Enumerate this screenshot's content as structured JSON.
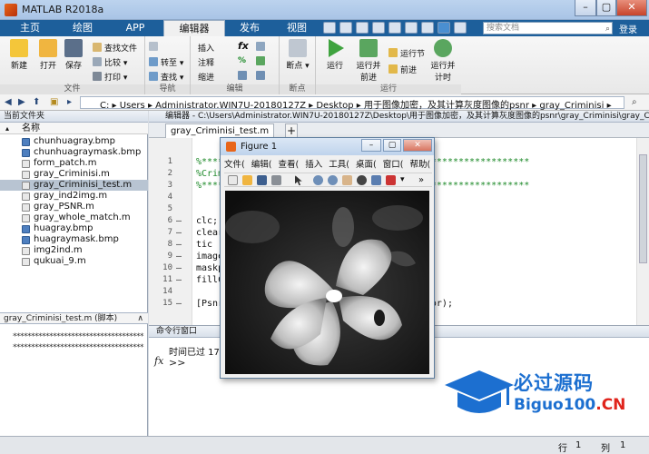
{
  "window": {
    "title": "MATLAB R2018a"
  },
  "tabs": [
    "主页",
    "绘图",
    "APP",
    "编辑器",
    "发布",
    "视图"
  ],
  "active_tab": "编辑器",
  "search": {
    "placeholder": "搜索文档"
  },
  "login_label": "登录",
  "ribbon": {
    "file": {
      "new": "新建",
      "open": "打开",
      "save": "保存",
      "find_files": "查找文件",
      "compare": "比较",
      "print": "打印",
      "group": "文件"
    },
    "navigate": {
      "goto": "转至",
      "find": "查找",
      "group": "导航"
    },
    "edit": {
      "insert": "插入",
      "comment": "注释",
      "indent": "缩进",
      "fx": "fx",
      "group": "编辑"
    },
    "breakpoints": {
      "label": "断点",
      "group": "断点"
    },
    "run": {
      "run": "运行",
      "run_advance": "运行并\n前进",
      "run_section": "运行节",
      "advance": "前进",
      "run_time": "运行并\n计时",
      "group": "运行"
    }
  },
  "address": {
    "path": [
      "C:",
      "Users",
      "Administrator.WIN7U-20180127Z",
      "Desktop",
      "用于图像加密，及其计算灰度图像的psnr",
      "gray_Criminisi"
    ]
  },
  "left_panel": {
    "title": "当前文件夹",
    "column": "名称",
    "files": [
      {
        "name": "chunhuagray.bmp",
        "type": "img"
      },
      {
        "name": "chunhuagraymask.bmp",
        "type": "img"
      },
      {
        "name": "form_patch.m",
        "type": "m"
      },
      {
        "name": "gray_Criminisi.m",
        "type": "m"
      },
      {
        "name": "gray_Criminisi_test.m",
        "type": "m",
        "selected": true
      },
      {
        "name": "gray_ind2img.m",
        "type": "m"
      },
      {
        "name": "gray_PSNR.m",
        "type": "m"
      },
      {
        "name": "gray_whole_match.m",
        "type": "m"
      },
      {
        "name": "huagray.bmp",
        "type": "img"
      },
      {
        "name": "huagraymask.bmp",
        "type": "img"
      },
      {
        "name": "img2ind.m",
        "type": "m"
      },
      {
        "name": "qukuai_9.m",
        "type": "m"
      }
    ],
    "details_title": "gray_Criminisi_test.m  (脚本)",
    "details_line1": "************************************",
    "details_line2": "************************************"
  },
  "editor": {
    "header": "编辑器 - C:\\Users\\Administrator.WIN7U-20180127Z\\Desktop\\用于图像加密，及其计算灰度图像的psnr\\gray_Criminisi\\gray_Criminisi_test.m",
    "tab": "gray_Criminisi_test.m",
    "lines": [
      {
        "n": "1",
        "dash": "",
        "code": "%************************************************************",
        "comment": true
      },
      {
        "n": "2",
        "dash": "",
        "code": "%Crim",
        "comment": true
      },
      {
        "n": "3",
        "dash": "",
        "code": "%************************************************************",
        "comment": true
      },
      {
        "n": "4",
        "dash": "",
        "code": "",
        "comment": false
      },
      {
        "n": "5",
        "dash": "",
        "code": "",
        "comment": false
      },
      {
        "n": "6",
        "dash": "—",
        "code": "clc;",
        "comment": false
      },
      {
        "n": "7",
        "dash": "—",
        "code": "clear",
        "comment": false
      },
      {
        "n": "8",
        "dash": "—",
        "code": "tic",
        "comment": false
      },
      {
        "n": "9",
        "dash": "—",
        "code": "image",
        "comment": false
      },
      {
        "n": "10",
        "dash": "—",
        "code": "maskp",
        "comment": false
      },
      {
        "n": "11",
        "dash": "—",
        "code": "fillC",
        "comment": false
      },
      {
        "n": "14",
        "dash": "",
        "code": "",
        "comment": false
      },
      {
        "n": "15",
        "dash": "—",
        "code": "[Psnr                          path,fillColor);",
        "comment": false
      }
    ]
  },
  "command_window": {
    "title": "命令行窗口",
    "output": "时间已过 17",
    "prompt": ">>",
    "fx": "fx"
  },
  "status": {
    "row_label": "行",
    "row": "1",
    "col_label": "列",
    "col": "1"
  },
  "figure": {
    "title": "Figure 1",
    "menu": [
      "文件(",
      "编辑(",
      "查看(",
      "插入",
      "工具(",
      "桌面(",
      "窗口(",
      "帮助(",
      "»"
    ]
  },
  "watermark": {
    "line1": "必过源码",
    "line2a": "Biguo100",
    "line2b": ".CN"
  },
  "colors": {
    "tabbar": "#1d5f9b",
    "accent": "#1c6fd0",
    "watermark_red": "#e0241c"
  }
}
